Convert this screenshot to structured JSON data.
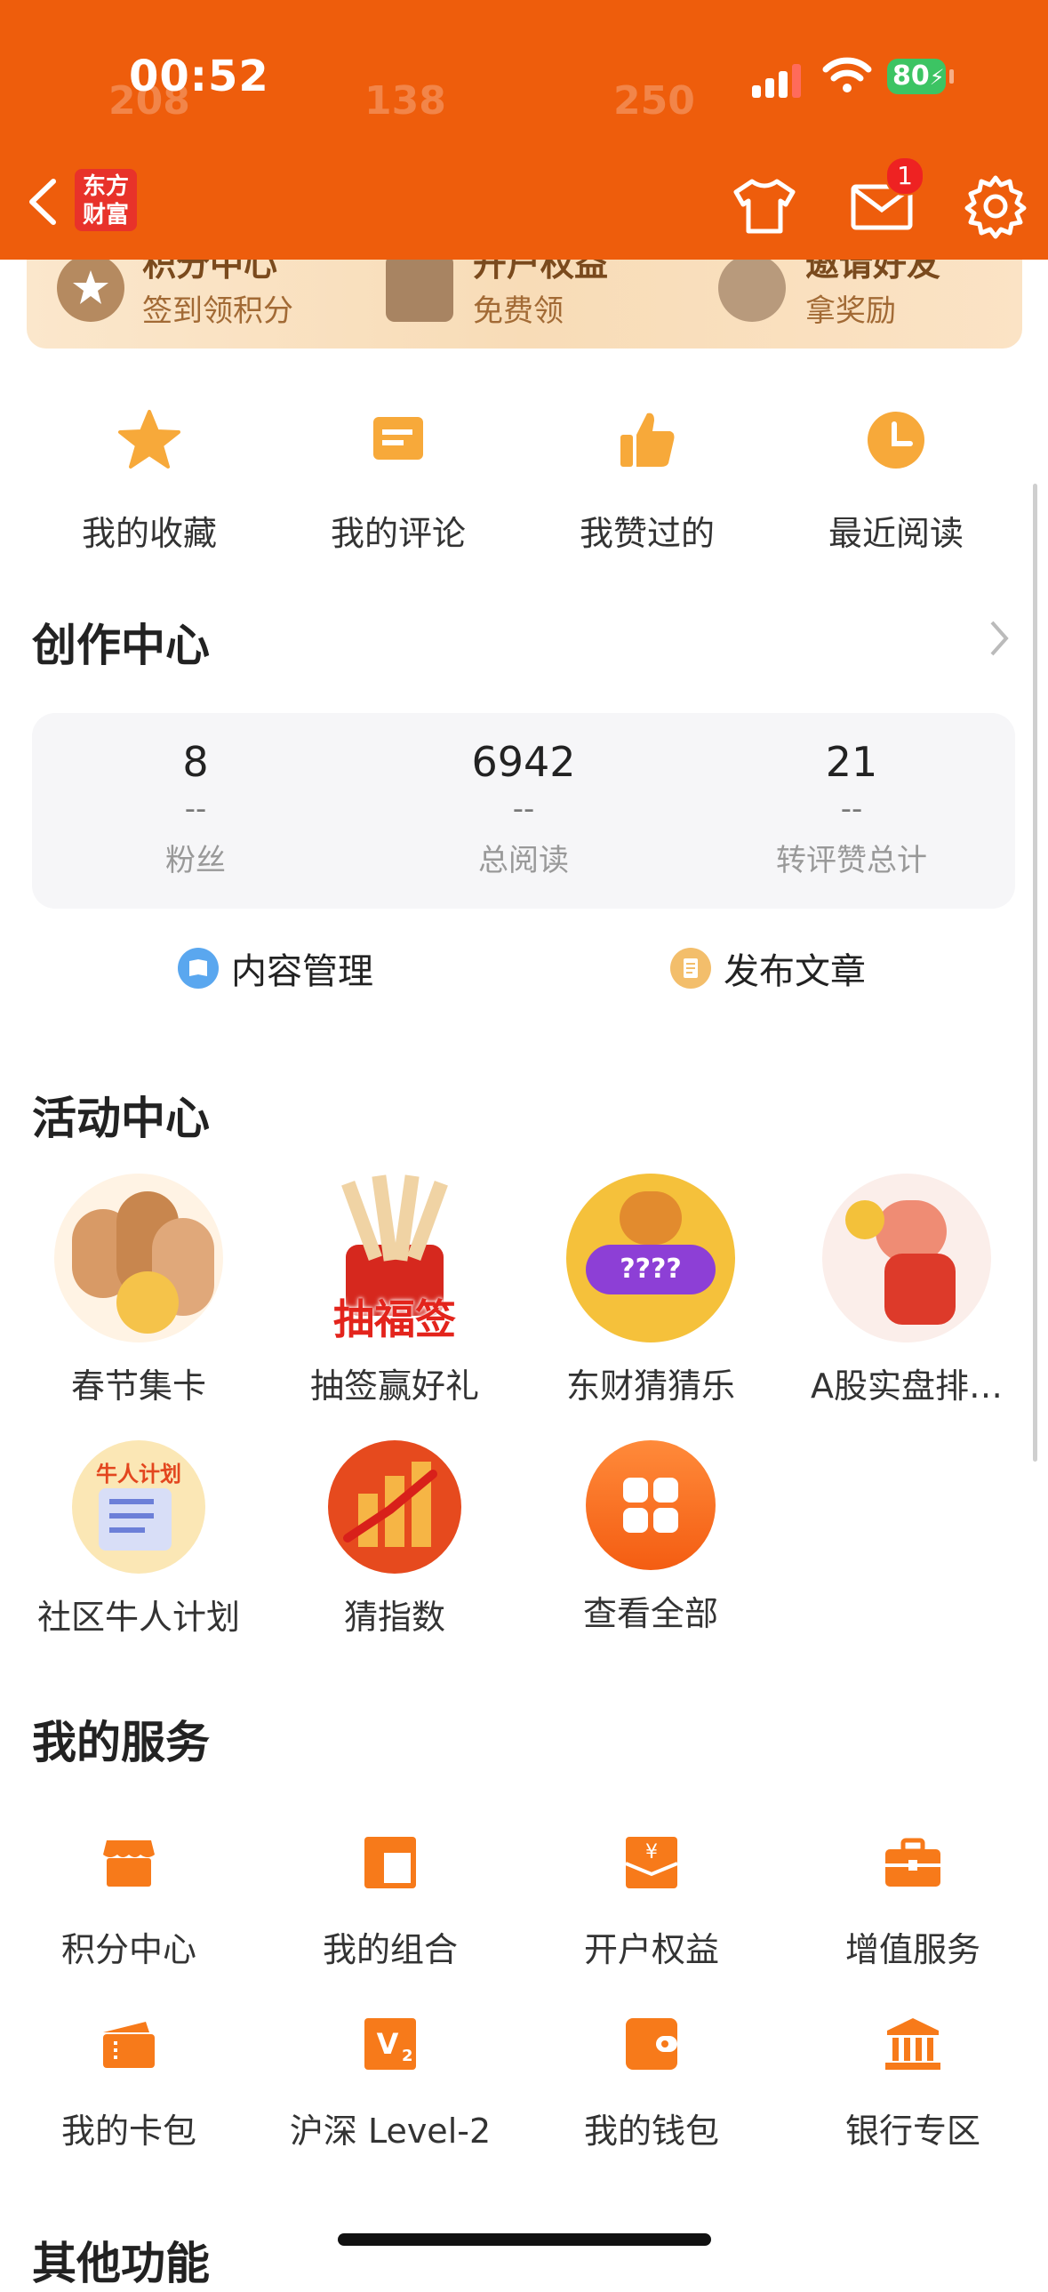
{
  "status_bar": {
    "time": "00:52",
    "battery": "80"
  },
  "header": {
    "logo_text": "东方财富",
    "mail_badge": "1"
  },
  "ghost_numbers": [
    "208",
    "138",
    "250"
  ],
  "banner": {
    "items": [
      {
        "title": "积分中心",
        "sub": "签到领积分"
      },
      {
        "title": "开户权益",
        "sub": "免费领"
      },
      {
        "title": "邀请好友",
        "sub": "拿奖励"
      }
    ]
  },
  "quick": [
    {
      "label": "我的收藏",
      "icon": "star-icon"
    },
    {
      "label": "我的评论",
      "icon": "comment-icon"
    },
    {
      "label": "我赞过的",
      "icon": "thumbs-up-icon"
    },
    {
      "label": "最近阅读",
      "icon": "clock-icon"
    }
  ],
  "creation": {
    "title": "创作中心",
    "stats": [
      {
        "value": "8",
        "delta": "--",
        "label": "粉丝"
      },
      {
        "value": "6942",
        "delta": "--",
        "label": "总阅读"
      },
      {
        "value": "21",
        "delta": "--",
        "label": "转评赞总计"
      }
    ],
    "actions": [
      "内容管理",
      "发布文章"
    ]
  },
  "activity": {
    "title": "活动中心",
    "items": [
      "春节集卡",
      "抽签赢好礼",
      "东财猜猜乐",
      "A股实盘排…",
      "社区牛人计划",
      "猜指数",
      "查看全部"
    ],
    "lottery_badge": "抽福签",
    "quiz_badge": "????",
    "plan_badge": "牛人计划"
  },
  "services": {
    "title": "我的服务",
    "items": [
      {
        "label": "积分中心",
        "icon": "shop-icon"
      },
      {
        "label": "我的组合",
        "icon": "portfolio-icon"
      },
      {
        "label": "开户权益",
        "icon": "yen-envelope-icon"
      },
      {
        "label": "增值服务",
        "icon": "briefcase-icon"
      },
      {
        "label": "我的卡包",
        "icon": "ticket-icon"
      },
      {
        "label": "沪深 Level-2",
        "icon": "level2-icon"
      },
      {
        "label": "我的钱包",
        "icon": "wallet-icon"
      },
      {
        "label": "银行专区",
        "icon": "bank-icon"
      }
    ]
  },
  "other": {
    "title": "其他功能"
  },
  "colors": {
    "header": "#ee5d0c",
    "accent": "#f77a1a",
    "icon_yellow": "#f7a93a"
  }
}
